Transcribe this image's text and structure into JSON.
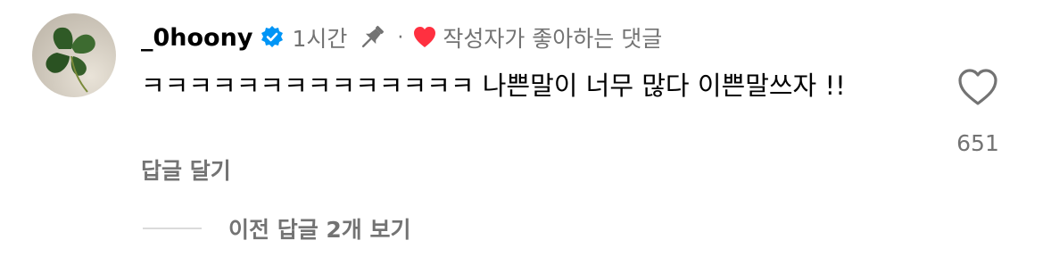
{
  "comment": {
    "username": "_0hoony",
    "verified_icon": "verified-badge-icon",
    "time": "1시간",
    "pin_icon": "pin-icon",
    "separator": "·",
    "creator_liked_icon": "red-heart-icon",
    "creator_liked_label": "작성자가 좋아하는 댓글",
    "text": "ㅋㅋㅋㅋㅋㅋㅋㅋㅋㅋㅋㅋㅋㅋ 나쁜말이 너무 많다 이쁜말쓰자 !!",
    "reply_label": "답글 달기",
    "like_icon": "heart-outline-icon",
    "like_count": "651",
    "view_replies_label": "이전 답글 2개 보기"
  },
  "colors": {
    "text_primary": "#000000",
    "text_secondary": "#737373",
    "verified_blue": "#0095f6",
    "liked_red": "#ff3040",
    "divider": "#dbdbdb"
  }
}
